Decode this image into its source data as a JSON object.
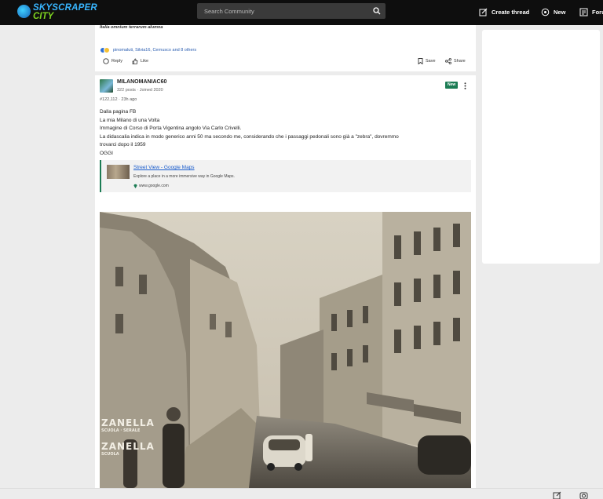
{
  "app": {
    "logo_line1": "SKYSCRAPER",
    "logo_line2": "CITY",
    "accent": "#1c7c54"
  },
  "header": {
    "search_placeholder": "Search Community",
    "nav": [
      {
        "label": "Create thread",
        "icon": "edit-icon"
      },
      {
        "label": "New",
        "icon": "new-icon"
      },
      {
        "label": "Foru",
        "icon": "forums-icon"
      }
    ]
  },
  "prev_post": {
    "motto": "Italia omnium terrarum alumna",
    "reactions_text": "pinomaluti, Silvia16, Cernusco and 8 others",
    "reply_label": "Reply",
    "like_label": "Like",
    "save_label": "Save",
    "share_label": "Share"
  },
  "post": {
    "username": "MILANOMANIAC60",
    "user_meta": "322 posts · Joined 2020",
    "badge": "New",
    "post_meta": "#122,112 · 23h ago",
    "lines": [
      "Dalla pagina FB",
      "La mia Milano di una Volta",
      "Immagine di Corso di Porta Vigentina angolo Via Carlo Crivelli.",
      "La didascalia indica in modo generico anni 50 ma secondo me, considerando che i passaggi pedonali sono già a \"zebra\", dovremmo",
      "trovarci dopo il 1959",
      "OGGI"
    ],
    "link": {
      "title": "Street View - Google Maps",
      "description": "Explore a place in a more immersive way in Google Maps.",
      "url": "www.google.com"
    },
    "photo_signs": {
      "sign1": "ZANELLA",
      "sign2": "SCUOLA · SERALE",
      "sign3": "ZANELLA",
      "sign4": "SCUOLA"
    }
  }
}
